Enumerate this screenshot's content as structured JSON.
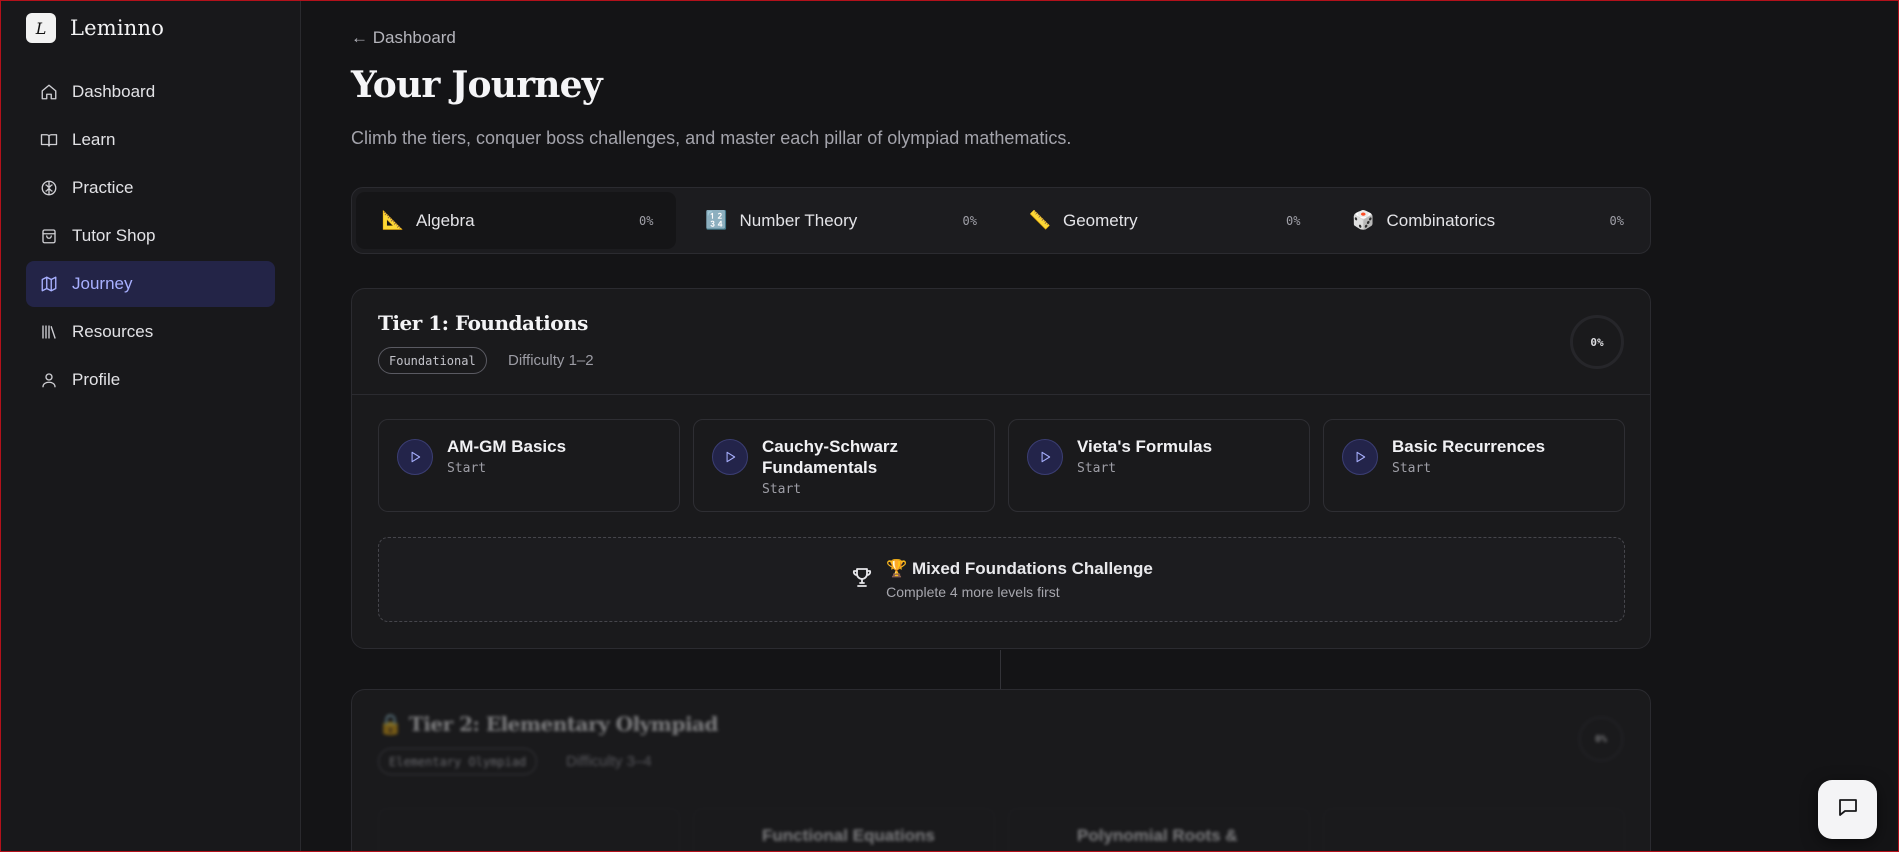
{
  "brand": {
    "logo_letter": "L",
    "name": "Leminno"
  },
  "nav": [
    {
      "label": "Dashboard",
      "icon": "home-icon"
    },
    {
      "label": "Learn",
      "icon": "book-icon"
    },
    {
      "label": "Practice",
      "icon": "brain-icon"
    },
    {
      "label": "Tutor Shop",
      "icon": "shopping-bag-icon"
    },
    {
      "label": "Journey",
      "icon": "map-icon",
      "active": true
    },
    {
      "label": "Resources",
      "icon": "library-icon"
    },
    {
      "label": "Profile",
      "icon": "user-icon"
    }
  ],
  "header": {
    "back_link": "← Dashboard",
    "title": "Your Journey",
    "subtitle": "Climb the tiers, conquer boss challenges, and master each pillar of olympiad mathematics."
  },
  "pillars": [
    {
      "emoji": "📐",
      "label": "Algebra",
      "percent": "0%",
      "active": true
    },
    {
      "emoji": "🔢",
      "label": "Number Theory",
      "percent": "0%"
    },
    {
      "emoji": "📏",
      "label": "Geometry",
      "percent": "0%"
    },
    {
      "emoji": "🎲",
      "label": "Combinatorics",
      "percent": "0%"
    }
  ],
  "tiers": [
    {
      "title": "Tier 1: Foundations",
      "badge": "Foundational",
      "difficulty": "Difficulty 1–2",
      "progress": "0%",
      "levels": [
        {
          "name": "AM-GM Basics",
          "status": "Start"
        },
        {
          "name": "Cauchy-Schwarz Fundamentals",
          "status": "Start"
        },
        {
          "name": "Vieta's Formulas",
          "status": "Start"
        },
        {
          "name": "Basic Recurrences",
          "status": "Start"
        }
      ],
      "boss": {
        "title": "🏆 Mixed Foundations Challenge",
        "subtitle": "Complete 4 more levels first"
      }
    },
    {
      "lock": "🔒",
      "title": "Tier 2: Elementary Olympiad",
      "badge": "Elementary Olympiad",
      "difficulty": "Difficulty 3–4",
      "progress": "0%",
      "levels": [
        {
          "name": "",
          "status": ""
        },
        {
          "name": "Functional Equations",
          "status": ""
        },
        {
          "name": "Polynomial Roots &",
          "status": ""
        },
        {
          "name": "",
          "status": ""
        }
      ]
    }
  ],
  "colors": {
    "accent": "#a8b0ff",
    "active_bg": "#232447",
    "background": "#141416"
  }
}
